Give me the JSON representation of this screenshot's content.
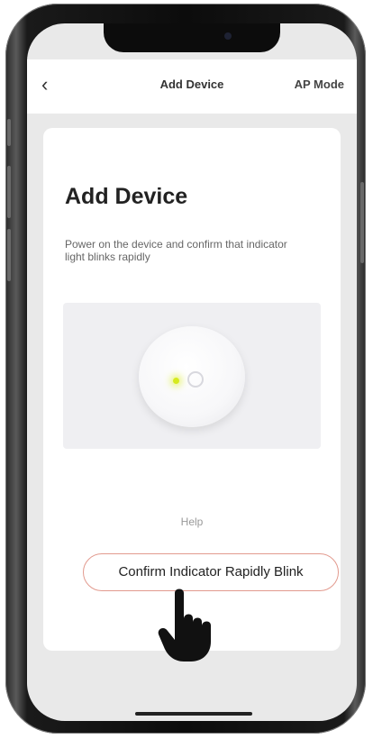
{
  "header": {
    "back_icon": "chevron-left-icon",
    "title": "Add Device",
    "ap_mode": "AP Mode"
  },
  "card": {
    "title": "Add Device",
    "description": "Power on the device and confirm that indicator light blinks rapidly",
    "help": "Help",
    "confirm_button": "Confirm Indicator Rapidly Blink"
  },
  "colors": {
    "screen_bg": "#e9e9e9",
    "card_bg": "#ffffff",
    "indicator": "#d6ea1e",
    "button_border": "#e29a8e"
  },
  "icons": {
    "pointer": "pointing-hand-icon"
  }
}
